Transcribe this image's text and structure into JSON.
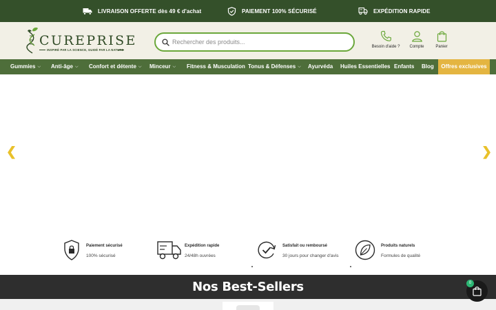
{
  "topbar": {
    "items": [
      {
        "label": "LIVRAISON OFFERTE dès 49 € d'achat",
        "icon": "delivery-truck-icon"
      },
      {
        "label": "PAIEMENT 100% SÉCURISÉ",
        "icon": "shield-check-icon"
      },
      {
        "label": "EXPÉDITION RAPIDE",
        "icon": "fast-truck-icon"
      }
    ]
  },
  "header": {
    "brand": "CUREPRISE",
    "tagline": "INSPIRÉ PAR LA SCIENCE, GUIDÉ PAR LA NATURE",
    "search_placeholder": "Rechercher des produits...",
    "help_label": "Besoin d'aide ?",
    "account_label": "Compte",
    "cart_label": "Panier"
  },
  "nav": {
    "items": [
      {
        "label": "Gummies",
        "chevron": "⌵"
      },
      {
        "label": "Anti-âge",
        "chevron": "⌵"
      },
      {
        "label": "Confort et détente",
        "chevron": "⌵"
      },
      {
        "label": "Minceur",
        "chevron": "⌵"
      },
      {
        "label": "Fitness & Musculation",
        "chevron": ""
      },
      {
        "label": "Tonus & Défenses",
        "chevron": "⌵"
      },
      {
        "label": "Ayurvéda",
        "chevron": ""
      },
      {
        "label": "Huiles Essentielles",
        "chevron": ""
      },
      {
        "label": "Enfants",
        "chevron": ""
      },
      {
        "label": "Blog",
        "chevron": ""
      }
    ],
    "offer_label": "Offres exclusives"
  },
  "hero": {
    "prev_arrow": "❮",
    "next_arrow": "❯"
  },
  "features": [
    {
      "title": "Paiement sécurisé",
      "desc": "100% sécurisé",
      "icon": "lock-shield-icon"
    },
    {
      "title": "Expédition rapide",
      "desc": "24/48h ouvrées",
      "icon": "truck-icon"
    },
    {
      "title": "Satisfait ou remboursé",
      "desc": "30 jours pour changer d'avis",
      "icon": "refresh-check-icon"
    },
    {
      "title": "Produits naturels",
      "desc": "Formules de qualité",
      "icon": "leaf-icon"
    }
  ],
  "bestsellers": {
    "title": "Nos Best-Sellers"
  },
  "cart_float": {
    "count": "0"
  },
  "colors": {
    "topbar": "#34502a",
    "nav": "#4e6e3a",
    "offer": "#e4b541",
    "search_border": "#6aa73a",
    "arrow": "#e9c12a"
  }
}
